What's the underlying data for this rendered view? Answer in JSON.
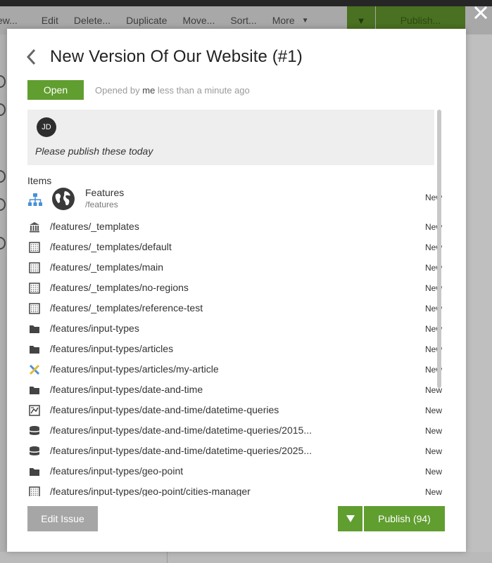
{
  "background": {
    "toolbar": {
      "items": [
        "ew...",
        "Edit",
        "Delete...",
        "Duplicate",
        "Move...",
        "Sort..."
      ],
      "more_label": "More",
      "publish_label": "Publish..."
    }
  },
  "modal": {
    "title": "New Version Of Our Website (#1)",
    "status": "Open",
    "opened_prefix": "Opened by",
    "opened_by": "me",
    "opened_when": "less than a minute ago",
    "comment": {
      "initials": "JD",
      "text": "Please publish these today"
    },
    "items_label": "Items",
    "root_item": {
      "name": "Features",
      "path": "/features",
      "status": "New"
    },
    "items": [
      {
        "icon": "template-folder-icon",
        "path": "/features/_templates",
        "status": "New"
      },
      {
        "icon": "page-template-icon",
        "path": "/features/_templates/default",
        "status": "New"
      },
      {
        "icon": "page-template-icon",
        "path": "/features/_templates/main",
        "status": "New"
      },
      {
        "icon": "page-template-icon",
        "path": "/features/_templates/no-regions",
        "status": "New"
      },
      {
        "icon": "page-template-icon",
        "path": "/features/_templates/reference-test",
        "status": "New"
      },
      {
        "icon": "folder-icon",
        "path": "/features/input-types",
        "status": "New"
      },
      {
        "icon": "folder-icon",
        "path": "/features/input-types/articles",
        "status": "New"
      },
      {
        "icon": "content-type-icon",
        "path": "/features/input-types/articles/my-article",
        "status": "New"
      },
      {
        "icon": "folder-icon",
        "path": "/features/input-types/date-and-time",
        "status": "New"
      },
      {
        "icon": "query-icon",
        "path": "/features/input-types/date-and-time/datetime-queries",
        "status": "New"
      },
      {
        "icon": "database-icon",
        "path": "/features/input-types/date-and-time/datetime-queries/2015...",
        "status": "New"
      },
      {
        "icon": "database-icon",
        "path": "/features/input-types/date-and-time/datetime-queries/2025...",
        "status": "New"
      },
      {
        "icon": "folder-icon",
        "path": "/features/input-types/geo-point",
        "status": "New"
      },
      {
        "icon": "page-template-icon",
        "path": "/features/input-types/geo-point/cities-manager",
        "status": "New"
      }
    ],
    "footer": {
      "edit_label": "Edit Issue",
      "publish_label": "Publish (94)"
    }
  },
  "colors": {
    "accent_green": "#609e2f",
    "edit_gray": "#a6a6a6"
  }
}
